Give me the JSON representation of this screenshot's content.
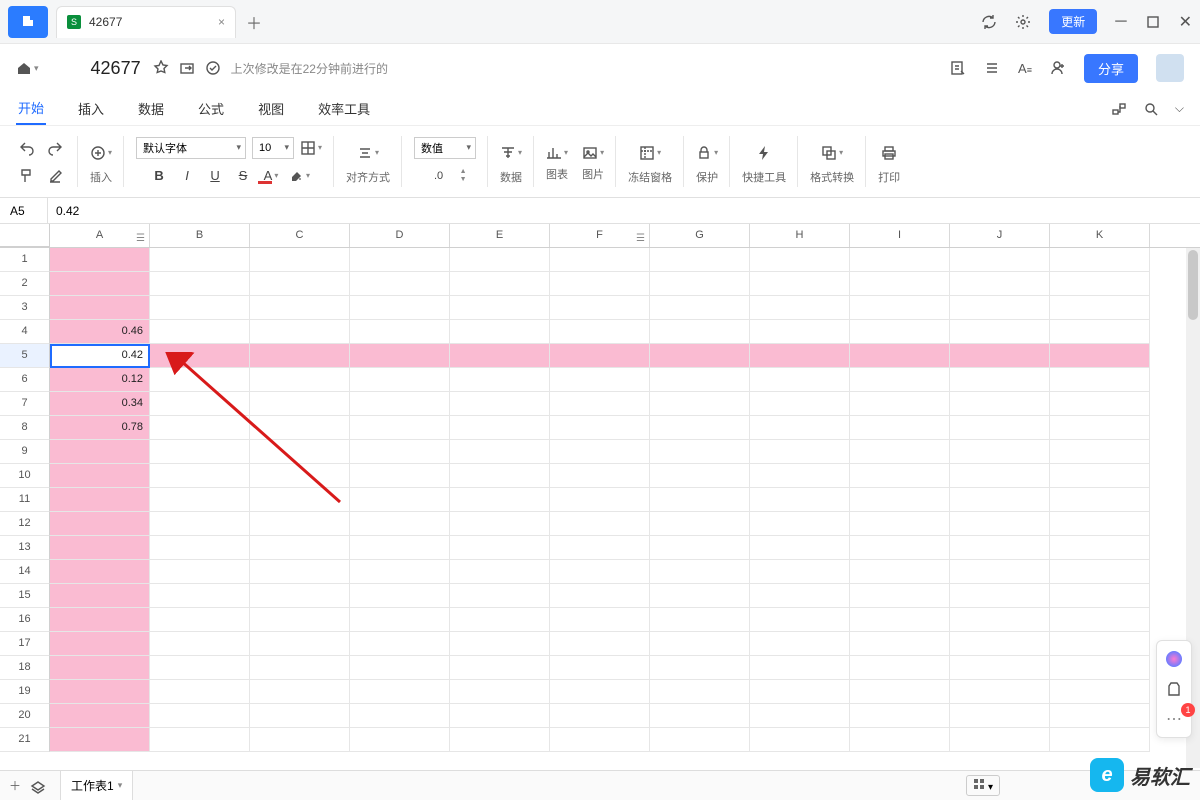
{
  "tab": {
    "title": "42677"
  },
  "update_label": "更新",
  "doc": {
    "title": "42677",
    "status": "上次修改是在22分钟前进行的"
  },
  "share_label": "分享",
  "menu": [
    "开始",
    "插入",
    "数据",
    "公式",
    "视图",
    "效率工具"
  ],
  "ribbon": {
    "insert": "插入",
    "font": "默认字体",
    "font_size": "10",
    "align": "对齐方式",
    "num_format": "数值",
    "num_decimal": ".0",
    "data": "数据",
    "chart": "图表",
    "image": "图片",
    "freeze": "冻结窗格",
    "protect": "保护",
    "quick": "快捷工具",
    "format_conv": "格式转换",
    "print": "打印"
  },
  "name_box": "A5",
  "formula": "0.42",
  "columns": [
    "A",
    "B",
    "C",
    "D",
    "E",
    "F",
    "G",
    "H",
    "I",
    "J",
    "K"
  ],
  "rows": [
    1,
    2,
    3,
    4,
    5,
    6,
    7,
    8,
    9,
    10,
    11,
    12,
    13,
    14,
    15,
    16,
    17,
    18,
    19,
    20,
    21
  ],
  "cells": {
    "A4": "0.46",
    "A5": "0.42",
    "A6": "0.12",
    "A7": "0.34",
    "A8": "0.78"
  },
  "active_cell": "A5",
  "pink_col": "A",
  "pink_row": 5,
  "sheet": {
    "name": "工作表1"
  },
  "watermark": "易软汇",
  "float_badge": "1"
}
